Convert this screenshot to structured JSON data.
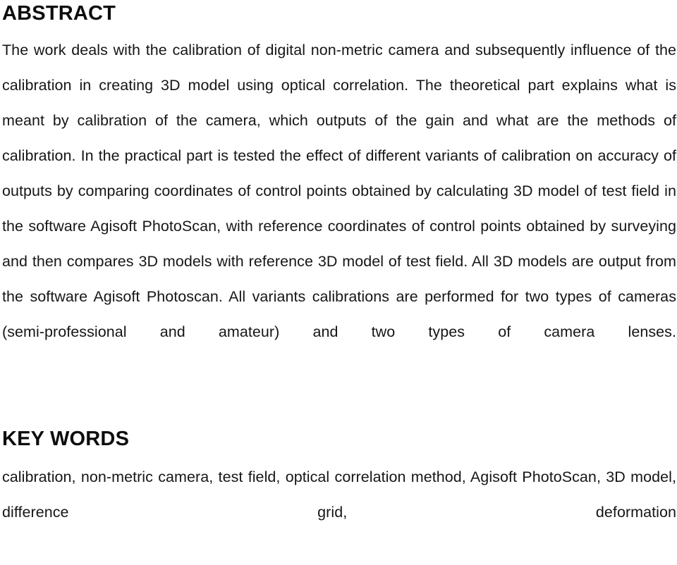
{
  "document": {
    "sections": [
      {
        "id": "abstract",
        "heading": "ABSTRACT",
        "body": "The work deals with the calibration of digital non-metric camera and subsequently influence of the calibration in creating 3D model using optical correlation. The theoretical part explains what is meant by calibration of the camera, which outputs of the gain and what are the methods of calibration. In the practical part is tested the effect of different variants of calibration on accuracy of outputs by comparing coordinates of control points obtained by calculating 3D model of test field in the software Agisoft PhotoScan, with reference coordinates of control points obtained by surveying and then compares 3D models with reference 3D model of test field. All 3D models are output from the software Agisoft Photoscan. All variants calibrations are performed for two types of cameras (semi-professional and amateur) and two types of camera lenses."
      },
      {
        "id": "keywords",
        "heading": "KEY WORDS",
        "body": "calibration, non-metric camera, test field, optical correlation method, Agisoft PhotoScan, 3D model, difference grid, deformation"
      }
    ],
    "colors": {
      "page_background": "#ffffff",
      "text": "#161616",
      "heading": "#0d0d0d"
    }
  }
}
